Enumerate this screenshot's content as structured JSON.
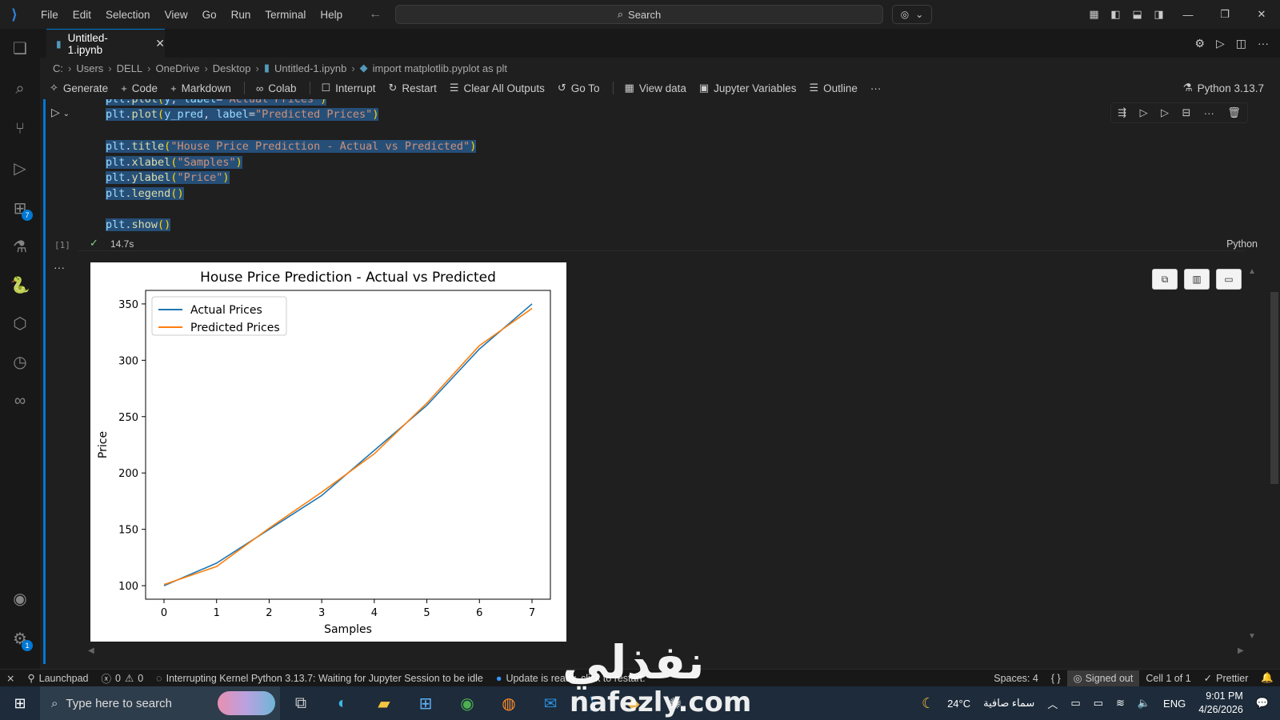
{
  "titlebar": {
    "menu": [
      "File",
      "Edit",
      "Selection",
      "View",
      "Go",
      "Run",
      "Terminal",
      "Help"
    ],
    "search_label": "Search"
  },
  "tab": {
    "name": "Untitled-1.ipynb"
  },
  "breadcrumb": [
    "C:",
    "Users",
    "DELL",
    "OneDrive",
    "Desktop",
    "Untitled-1.ipynb",
    "import matplotlib.pyplot as plt"
  ],
  "notebook_toolbar": {
    "generate": "Generate",
    "code": "Code",
    "markdown": "Markdown",
    "colab": "Colab",
    "interrupt": "Interrupt",
    "restart": "Restart",
    "clear_outputs": "Clear All Outputs",
    "goto": "Go To",
    "view_data": "View data",
    "jupyter_variables": "Jupyter Variables",
    "outline": "Outline",
    "more": "···",
    "kernel": "Python 3.13.7"
  },
  "cell": {
    "code_lines": [
      "plt.plot(y, label=\"Actual Prices\")",
      "plt.plot(y_pred, label=\"Predicted Prices\")",
      "",
      "plt.title(\"House Price Prediction - Actual vs Predicted\")",
      "plt.xlabel(\"Samples\")",
      "plt.ylabel(\"Price\")",
      "plt.legend()",
      "",
      "plt.show()"
    ],
    "exec_count": "[1]",
    "exec_time": "14.7s",
    "language": "Python"
  },
  "chart_data": {
    "type": "line",
    "title": "House Price Prediction - Actual vs Predicted",
    "xlabel": "Samples",
    "ylabel": "Price",
    "x": [
      0,
      1,
      2,
      3,
      4,
      5,
      6,
      7
    ],
    "xlim": [
      -0.35,
      7.35
    ],
    "ylim": [
      88,
      362
    ],
    "yticks": [
      100,
      150,
      200,
      250,
      300,
      350
    ],
    "legend_position": "top-left",
    "series": [
      {
        "name": "Actual Prices",
        "color": "#1f77b4",
        "values": [
          100,
          120,
          150,
          180,
          220,
          260,
          310,
          350
        ]
      },
      {
        "name": "Predicted Prices",
        "color": "#ff7f0e",
        "values": [
          101,
          117,
          151,
          183,
          217,
          262,
          313,
          346
        ]
      }
    ]
  },
  "statusbar": {
    "launchpad": "Launchpad",
    "problems": "0",
    "warnings": "0",
    "kernel_status": "Interrupting Kernel Python 3.13.7: Waiting for Jupyter Session to be idle",
    "update": "Update is ready, click to restart.",
    "spaces": "Spaces: 4",
    "braces": "{ }",
    "signed_out": "Signed out",
    "cell_pos": "Cell 1 of 1",
    "prettier": "Prettier"
  },
  "watermark": {
    "arabic": "نفذلي",
    "latin": "nafezly.com"
  },
  "taskbar": {
    "search_placeholder": "Type here to search",
    "weather_temp": "24°C",
    "weather_text": "سماء صافية",
    "lang": "ENG",
    "time": "9:01 PM",
    "date": "4/26/2026"
  }
}
